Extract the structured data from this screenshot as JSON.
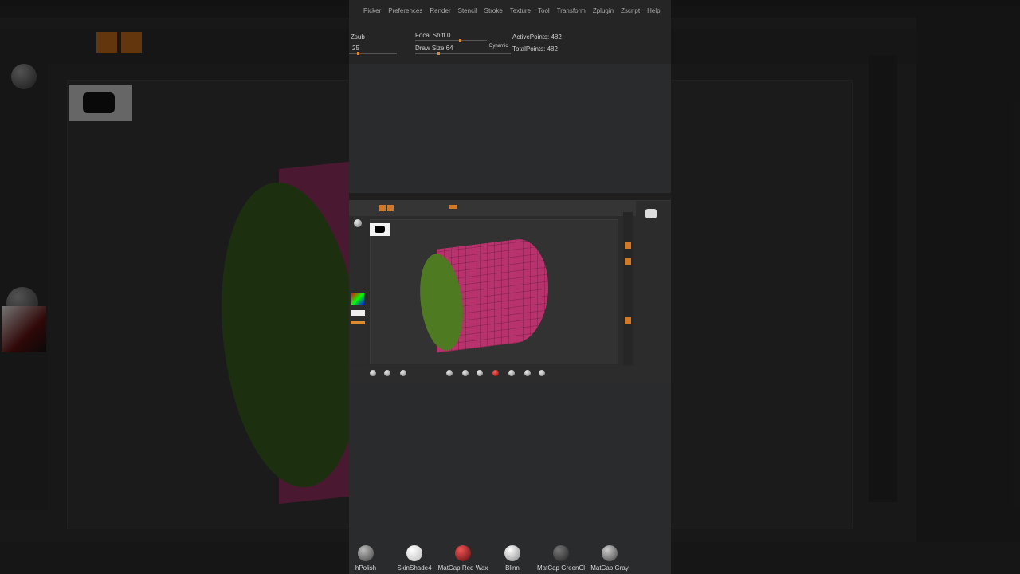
{
  "app": {
    "menu": [
      "Picker",
      "Preferences",
      "Render",
      "Stencil",
      "Stroke",
      "Texture",
      "Tool",
      "Transform",
      "Zplugin",
      "Zscript",
      "Help"
    ]
  },
  "toolbar": {
    "zsub_label": "Zsub",
    "z_intensity_value": "25",
    "focal_shift_label": "Focal Shift 0",
    "draw_size_label": "Draw Size 64",
    "dynamic_label": "Dynamic",
    "active_points": "ActivePoints: 482",
    "total_points": "TotalPoints: 482"
  },
  "materials": [
    {
      "label": "hPolish",
      "color": "#8a8a8a"
    },
    {
      "label": "SkinShade4",
      "color": "#e6e6e6"
    },
    {
      "label": "MatCap Red Wax",
      "color": "#8c2020"
    },
    {
      "label": "Blinn",
      "color": "#cfcfcf"
    },
    {
      "label": "MatCap GreenCl",
      "color": "#3d3d3d"
    },
    {
      "label": "MatCap Gray",
      "color": "#7a7a7a"
    }
  ],
  "colors": {
    "accent": "#e08a2e",
    "mesh_body": "#b8336e",
    "mesh_cap": "#4e7a22"
  }
}
